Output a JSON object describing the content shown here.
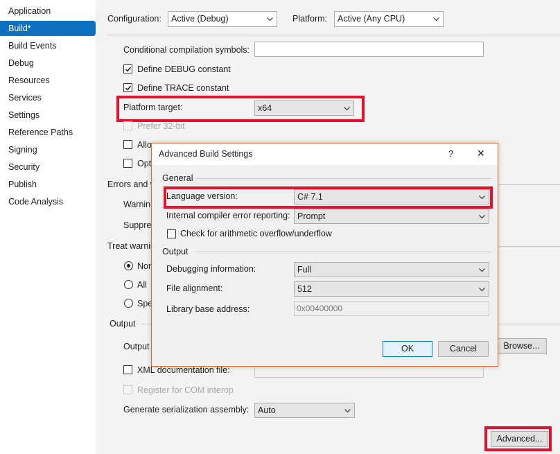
{
  "sidebar": {
    "items": [
      {
        "label": "Application"
      },
      {
        "label": "Build*"
      },
      {
        "label": "Build Events"
      },
      {
        "label": "Debug"
      },
      {
        "label": "Resources"
      },
      {
        "label": "Services"
      },
      {
        "label": "Settings"
      },
      {
        "label": "Reference Paths"
      },
      {
        "label": "Signing"
      },
      {
        "label": "Security"
      },
      {
        "label": "Publish"
      },
      {
        "label": "Code Analysis"
      }
    ],
    "active_index": 1,
    "accent_color": "#0e70c0"
  },
  "header": {
    "configuration_label": "Configuration:",
    "configuration_value": "Active (Debug)",
    "platform_label": "Platform:",
    "platform_value": "Active (Any CPU)"
  },
  "general": {
    "conditional_symbols_label": "Conditional compilation symbols:",
    "conditional_symbols_value": "",
    "define_debug_label": "Define DEBUG constant",
    "define_debug_checked": true,
    "define_trace_label": "Define TRACE constant",
    "define_trace_checked": true,
    "platform_target_label": "Platform target:",
    "platform_target_value": "x64",
    "prefer32_label": "Prefer 32-bit",
    "allow_unsafe_label": "Allo",
    "optimize_label": "Opt"
  },
  "errors": {
    "section_label": "Errors and w",
    "warning_level_label": "Warnin",
    "suppress_label": "Suppres"
  },
  "treat_warnings": {
    "section_label": "Treat warnin",
    "options": [
      "Nor",
      "All",
      "Spe"
    ],
    "selected_index": 0
  },
  "output": {
    "section_label": "Output",
    "output_path_label": "Output",
    "browse_label": "Browse...",
    "xml_doc_label": "XML documentation file:",
    "register_com_label": "Register for COM interop",
    "serialization_label": "Generate serialization assembly:",
    "serialization_value": "Auto",
    "advanced_label": "Advanced..."
  },
  "dialog": {
    "title": "Advanced Build Settings",
    "help_glyph": "?",
    "close_glyph": "✕",
    "general_label": "General",
    "language_version_label": "Language version:",
    "language_version_value": "C# 7.1",
    "internal_error_label": "Internal compiler error reporting:",
    "internal_error_value": "Prompt",
    "overflow_label": "Check for arithmetic overflow/underflow",
    "output_label": "Output",
    "debug_info_label": "Debugging information:",
    "debug_info_value": "Full",
    "file_alignment_label": "File alignment:",
    "file_alignment_value": "512",
    "base_address_label": "Library base address:",
    "base_address_value": "0x00400000",
    "ok_label": "OK",
    "cancel_label": "Cancel"
  },
  "highlight_color": "#e8112d"
}
